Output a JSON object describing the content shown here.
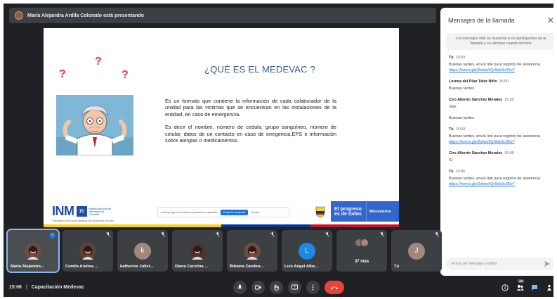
{
  "presenting": {
    "text": "María Alejandra Ardila Colorado está presentando"
  },
  "slide": {
    "title": "¿QUÉ ES EL MEDEVAC ?",
    "question_marks": [
      "?",
      "?",
      "?"
    ],
    "paragraph1": "Es un formato que contiene la información de cada colaborador de la unidad para las victimas que se encuentran en las instalaciones de la entidad, en caso de emergencia.",
    "paragraph2": "Es decir el nombre, número de cedula, grupo sanguíneo, número de celular, datos de un contacto en caso de emrgencia,EPS e información sobre alergias o medicamentos.",
    "footer": {
      "inm_logo": "INM",
      "inm_badge": "15",
      "inm_name": "Instituto Nacional de Metrología de Colombia",
      "inm_tagline": "Trabajando juntos para asegurar las mediciones del país",
      "share_url": "meet.google.com está compartiendo tu pantalla.",
      "share_stop": "Dejar de compartir",
      "share_hide": "Ocultar",
      "progreso": [
        "El progreso",
        "es de todos"
      ],
      "ministry": "Mincomercio"
    }
  },
  "chat": {
    "title": "Mensajes de la llamada",
    "note": "Los mensajes solo se muestran a los participantes de la llamada y se eliminan cuando termina",
    "messages": [
      {
        "sender": "Tú",
        "time": "14:59",
        "lines": [
          "Buenas tardes, envío link para registro de asistencia"
        ],
        "link": "https://forms.gle/2efwo9Qr9de3c9Dv7"
      },
      {
        "sender": "Lorena del Pilar Tafur Niño",
        "time": "15:00",
        "lines": [
          "Buenas tardes"
        ],
        "link": ""
      },
      {
        "sender": "Ciro Alberto Sánchez Morales",
        "time": "15:02",
        "lines": [
          "Vale",
          "Buenas tardes"
        ],
        "link": ""
      },
      {
        "sender": "Tú",
        "time": "15:03",
        "lines": [
          "Buenas tardes, envío link para registro de asistencia"
        ],
        "link": "https://forms.gle/2efwo9Qr9de3c9Dv7"
      },
      {
        "sender": "Ciro Alberto Sánchez Morales",
        "time": "15:05",
        "lines": [
          "Sí"
        ],
        "link": ""
      },
      {
        "sender": "Tú",
        "time": "15:06",
        "lines": [
          "Buenas tardes, envío link para registro de asistencia"
        ],
        "link": "https://forms.gle/2efwo9Qr9de3c9Dv7"
      }
    ],
    "input_placeholder": "Envía un mensaje a todos"
  },
  "tiles": [
    {
      "name": "María Alejandra...",
      "initial": "",
      "color": "#6d4c41",
      "type": "photo",
      "active": true
    },
    {
      "name": "Camila Andrea ...",
      "initial": "",
      "color": "#5d4037",
      "type": "photo",
      "active": false
    },
    {
      "name": "katherine Juliet...",
      "initial": "k",
      "color": "#a1887f",
      "type": "initial",
      "active": false
    },
    {
      "name": "Diana Carolina ...",
      "initial": "",
      "color": "#4e342e",
      "type": "photo",
      "active": false
    },
    {
      "name": "Bibiana Zambra...",
      "initial": "",
      "color": "#6d4c41",
      "type": "photo",
      "active": false
    },
    {
      "name": "Luis Angel Albe...",
      "initial": "L",
      "color": "#1e88e5",
      "type": "initial",
      "active": false
    },
    {
      "name": "37 más",
      "initial": "",
      "color": "#8d6e63",
      "type": "more",
      "active": false
    },
    {
      "name": "Tú",
      "initial": "J",
      "color": "#a1887f",
      "type": "initial",
      "active": false
    }
  ],
  "bottom": {
    "time": "15:06",
    "separator": "|",
    "meeting_name": "Capacitación Medevac",
    "people_count": "46"
  },
  "colors": {
    "background": "#202124",
    "accent": "#1a73e8",
    "end_call": "#ea4335",
    "flag_yellow": "#fcd116",
    "flag_blue": "#003893",
    "flag_red": "#ce1126"
  }
}
